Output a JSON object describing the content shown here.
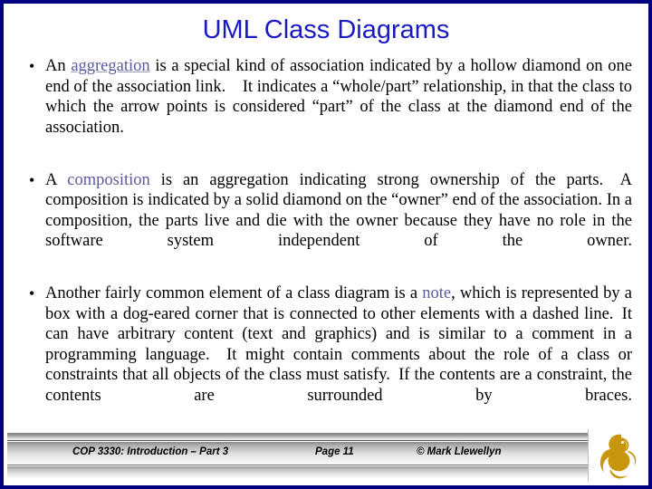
{
  "slide": {
    "border_color": "#000080",
    "background": "#ffffff"
  },
  "title": {
    "text": "UML Class Diagrams",
    "color": "#1a1ac4"
  },
  "bullets": [
    {
      "marker": "•",
      "lead": "An ",
      "keyword": "aggregation",
      "keyword_style": "underline",
      "rest": " is a special kind of association indicated by a hollow diamond on one end of the association link. It indicates a “whole/part” relationship, in that the class to which the arrow points is considered “part” of the class at the diamond end of the association."
    },
    {
      "marker": "•",
      "lead": "A ",
      "keyword": "composition",
      "keyword_style": "plain",
      "rest": " is an aggregation indicating strong ownership of the parts. A composition is indicated by a solid diamond on the “owner” end of the association. In a composition, the parts live and die with the owner because they have no role in the software system independent of the owner."
    },
    {
      "marker": "•",
      "lead": "Another fairly common element of a class diagram is a ",
      "keyword": "note",
      "keyword_style": "plain",
      "rest": ", which is represented by a box with a dog-eared corner that is connected to other elements with a dashed line. It can have arbitrary content (text and graphics) and is similar to a comment in a programming language. It might contain comments about the role of a class or constraints that all objects of the class must satisfy. If the contents are a constraint, the contents are surrounded by braces."
    }
  ],
  "keyword_color": "#5a5a9e",
  "footer": {
    "course": "COP 3330:  Introduction – Part 3",
    "page": "Page 11",
    "copyright": "© Mark Llewellyn",
    "logo_name": "ucf-pegasus-logo",
    "logo_color": "#c8960c"
  }
}
